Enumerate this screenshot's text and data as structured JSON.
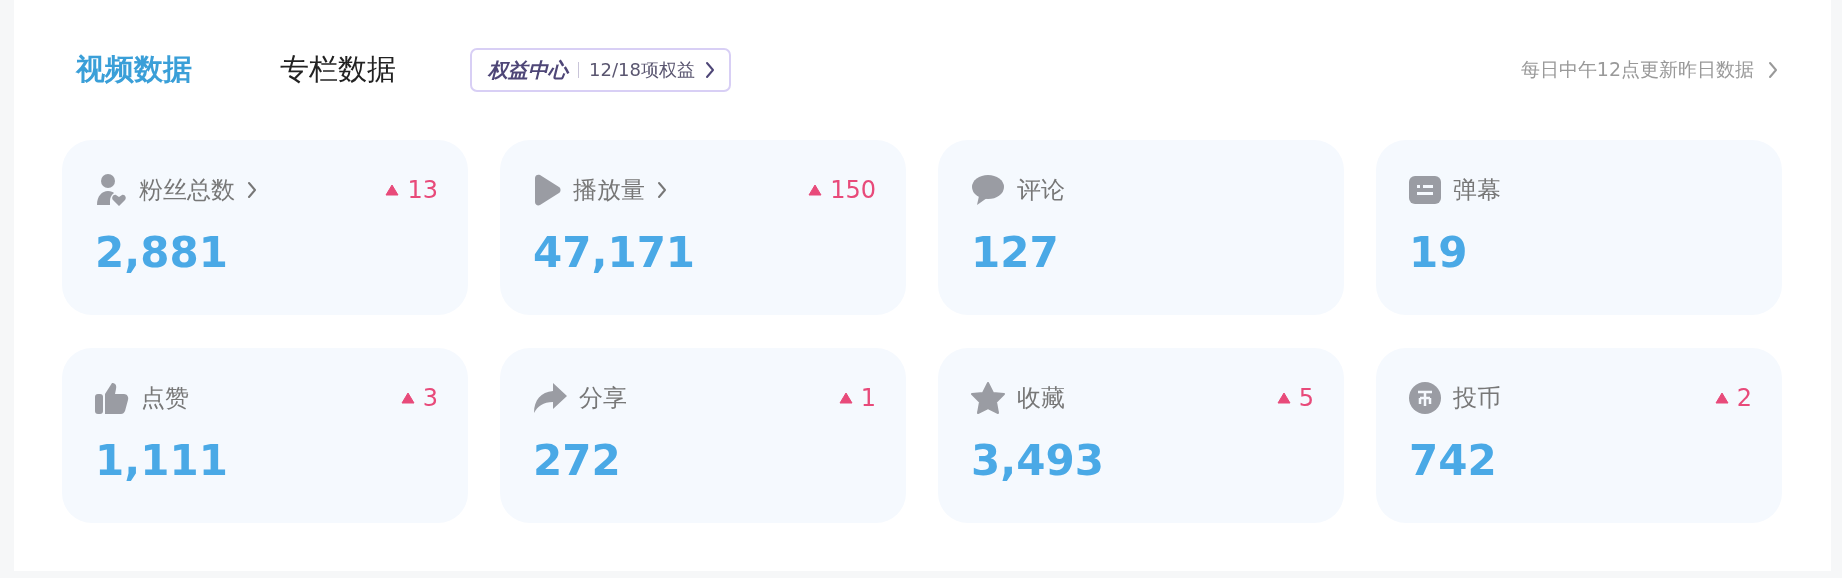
{
  "tabs": [
    {
      "label": "视频数据",
      "selected": true
    },
    {
      "label": "专栏数据",
      "selected": false
    }
  ],
  "benefits_badge": {
    "title": "权益中心",
    "count": "12/18项权益"
  },
  "update_note": "每日中午12点更新昨日数据",
  "cards": [
    {
      "label": "粉丝总数",
      "linked": true,
      "delta": "13",
      "value": "2,881"
    },
    {
      "label": "播放量",
      "linked": true,
      "delta": "150",
      "value": "47,171"
    },
    {
      "label": "评论",
      "linked": false,
      "value": "127"
    },
    {
      "label": "弹幕",
      "linked": false,
      "value": "19"
    },
    {
      "label": "点赞",
      "linked": false,
      "delta": "3",
      "value": "1,111"
    },
    {
      "label": "分享",
      "linked": false,
      "delta": "1",
      "value": "272"
    },
    {
      "label": "收藏",
      "linked": false,
      "delta": "5",
      "value": "3,493"
    },
    {
      "label": "投币",
      "linked": false,
      "delta": "2",
      "value": "742"
    }
  ]
}
